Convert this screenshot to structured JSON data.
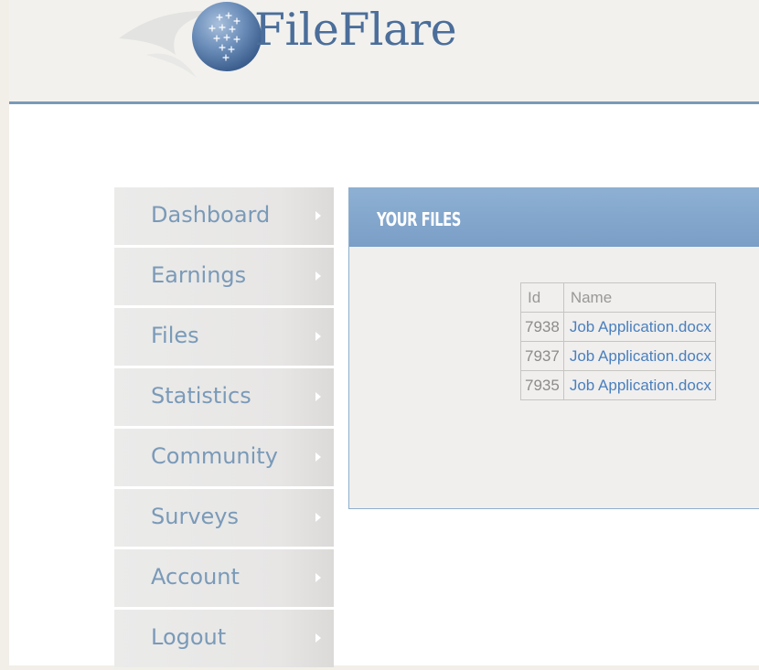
{
  "brand": {
    "name": "FileFlare"
  },
  "nav": {
    "items": [
      {
        "label": "Dashboard"
      },
      {
        "label": "Earnings"
      },
      {
        "label": "Files"
      },
      {
        "label": "Statistics"
      },
      {
        "label": "Community"
      },
      {
        "label": "Surveys"
      },
      {
        "label": "Account"
      },
      {
        "label": "Logout"
      }
    ]
  },
  "panel": {
    "title": "YOUR FILES",
    "table": {
      "headers": [
        "Id",
        "Name"
      ],
      "rows": [
        {
          "id": "7938",
          "name": "Job Application.docx"
        },
        {
          "id": "7937",
          "name": "Job Application.docx"
        },
        {
          "id": "7935",
          "name": "Job Application.docx"
        }
      ]
    }
  },
  "colors": {
    "accent": "#7a9ab8",
    "link": "#4a7fbd",
    "panel_header": "#8db0d3"
  }
}
